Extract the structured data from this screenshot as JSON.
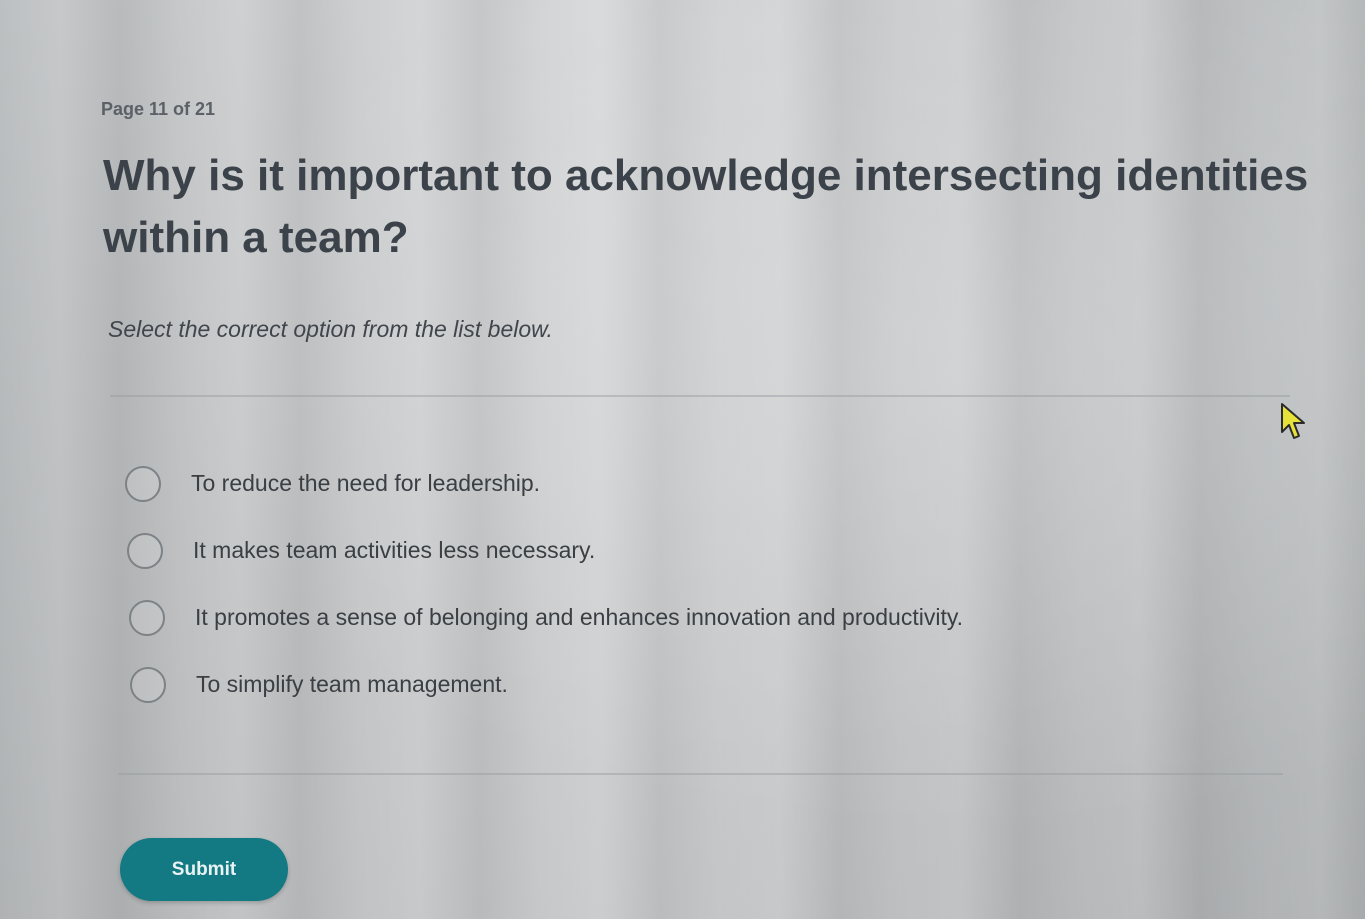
{
  "quiz": {
    "page_indicator": "Page 11 of 21",
    "question": "Why is it important to acknowledge intersecting identities within a team?",
    "instruction": "Select the correct option from the list below.",
    "options": [
      {
        "label": "To reduce the need for leadership.",
        "selected": false
      },
      {
        "label": "It makes team activities less necessary.",
        "selected": false
      },
      {
        "label": "It promotes a sense of belonging and enhances innovation and productivity.",
        "selected": false
      },
      {
        "label": "To simplify team management.",
        "selected": false
      }
    ],
    "submit_label": "Submit"
  },
  "colors": {
    "accent": "#137a83",
    "title_text": "#3b4249",
    "cursor_fill": "#e6e23a"
  },
  "icons": {
    "cursor": "mouse-pointer-icon"
  }
}
